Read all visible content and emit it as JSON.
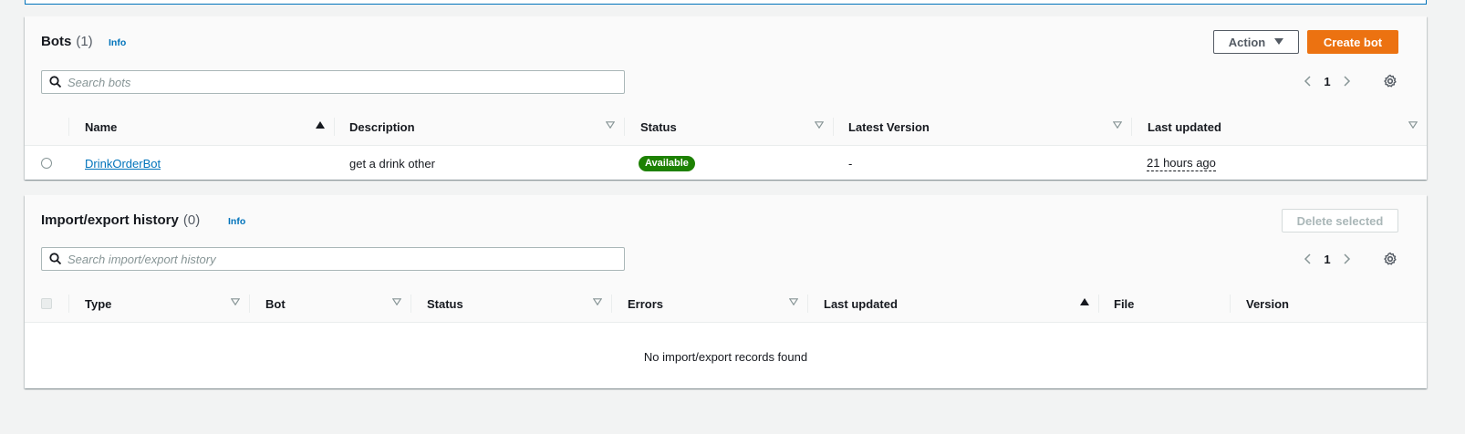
{
  "bots": {
    "title": "Bots",
    "count": "(1)",
    "info": "Info",
    "action_label": "Action",
    "create_label": "Create bot",
    "search_placeholder": "Search bots",
    "page": "1",
    "columns": [
      "Name",
      "Description",
      "Status",
      "Latest Version",
      "Last updated"
    ],
    "rows": [
      {
        "name": "DrinkOrderBot",
        "description": "get a drink other",
        "status": "Available",
        "latest_version": "-",
        "last_updated": "21 hours ago"
      }
    ]
  },
  "history": {
    "title": "Import/export history",
    "count": "(0)",
    "info": "Info",
    "delete_label": "Delete selected",
    "search_placeholder": "Search import/export history",
    "page": "1",
    "columns": [
      "Type",
      "Bot",
      "Status",
      "Errors",
      "Last updated",
      "File",
      "Version"
    ],
    "empty_message": "No import/export records found"
  },
  "colors": {
    "primary": "#ec7211",
    "link": "#0073bb",
    "status_available": "#1d8102",
    "background": "#f2f3f3"
  }
}
